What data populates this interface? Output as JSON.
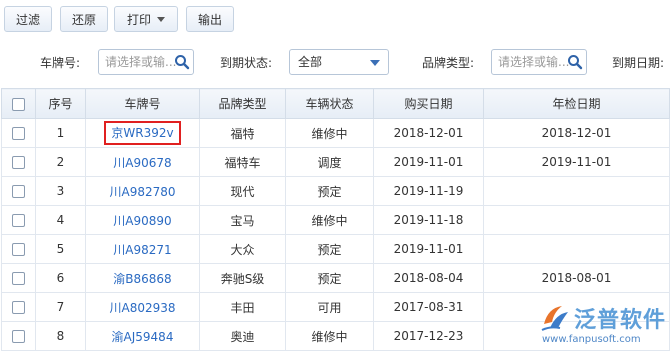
{
  "toolbar": {
    "filter_label": "过滤",
    "reset_label": "还原",
    "print_label": "打印",
    "export_label": "输出"
  },
  "filters": {
    "plate_label": "车牌号:",
    "plate_placeholder": "请选择或输...",
    "expire_label": "到期状态:",
    "expire_value": "全部",
    "brand_label": "品牌类型:",
    "brand_placeholder": "请选择或输...",
    "expire_date_label": "到期日期:"
  },
  "table": {
    "columns": [
      "序号",
      "车牌号",
      "品牌类型",
      "车辆状态",
      "购买日期",
      "年检日期"
    ],
    "rows": [
      {
        "no": "1",
        "plate": "京WR392v",
        "brand": "福特",
        "status": "维修中",
        "buy_date": "2018-12-01",
        "inspect_date": "2018-12-01"
      },
      {
        "no": "2",
        "plate": "川A90678",
        "brand": "福特车",
        "status": "调度",
        "buy_date": "2019-11-01",
        "inspect_date": "2019-11-01"
      },
      {
        "no": "3",
        "plate": "川A982780",
        "brand": "现代",
        "status": "预定",
        "buy_date": "2019-11-19",
        "inspect_date": ""
      },
      {
        "no": "4",
        "plate": "川A90890",
        "brand": "宝马",
        "status": "维修中",
        "buy_date": "2019-11-18",
        "inspect_date": ""
      },
      {
        "no": "5",
        "plate": "川A98271",
        "brand": "大众",
        "status": "预定",
        "buy_date": "2019-11-01",
        "inspect_date": ""
      },
      {
        "no": "6",
        "plate": "渝B86868",
        "brand": "奔驰S级",
        "status": "预定",
        "buy_date": "2018-08-04",
        "inspect_date": "2018-08-01"
      },
      {
        "no": "7",
        "plate": "川A802938",
        "brand": "丰田",
        "status": "可用",
        "buy_date": "2017-08-31",
        "inspect_date": ""
      },
      {
        "no": "8",
        "plate": "渝AJ59484",
        "brand": "奥迪",
        "status": "维修中",
        "buy_date": "2017-12-23",
        "inspect_date": ""
      }
    ]
  },
  "logo": {
    "name": "泛普软件",
    "url": "www.fanpusoft.com"
  },
  "colors": {
    "link": "#2a6ac2",
    "highlight": "#e02020"
  }
}
